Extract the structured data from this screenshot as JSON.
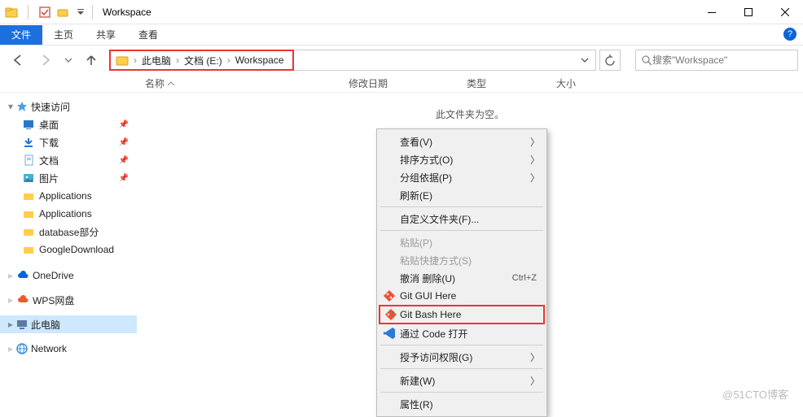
{
  "window": {
    "title": "Workspace"
  },
  "ribbon": {
    "file": "文件",
    "home": "主页",
    "share": "共享",
    "view": "查看"
  },
  "breadcrumb": {
    "items": [
      "此电脑",
      "文档 (E:)",
      "Workspace"
    ]
  },
  "search": {
    "placeholder": "搜索\"Workspace\""
  },
  "columns": {
    "name": "名称",
    "date": "修改日期",
    "type": "类型",
    "size": "大小"
  },
  "sidebar": {
    "quick_access": "快速访问",
    "pinned": [
      {
        "label": "桌面",
        "icon": "desktop"
      },
      {
        "label": "下载",
        "icon": "downloads"
      },
      {
        "label": "文档",
        "icon": "documents"
      },
      {
        "label": "图片",
        "icon": "pictures"
      }
    ],
    "folders": [
      "Applications",
      "Applications",
      "database部分",
      "GoogleDownload"
    ],
    "onedrive": "OneDrive",
    "wps": "WPS网盘",
    "this_pc": "此电脑",
    "network": "Network"
  },
  "empty": "此文件夹为空。",
  "context_menu": {
    "view": "查看(V)",
    "sort": "排序方式(O)",
    "group": "分组依据(P)",
    "refresh": "刷新(E)",
    "customize": "自定义文件夹(F)...",
    "paste": "粘贴(P)",
    "paste_shortcut": "粘贴快捷方式(S)",
    "undo_delete": "撤消 删除(U)",
    "undo_key": "Ctrl+Z",
    "git_gui": "Git GUI Here",
    "git_bash": "Git Bash Here",
    "open_code": "通过 Code 打开",
    "grant_access": "授予访问权限(G)",
    "new": "新建(W)",
    "properties": "属性(R)"
  },
  "watermark": "@51CTO博客"
}
